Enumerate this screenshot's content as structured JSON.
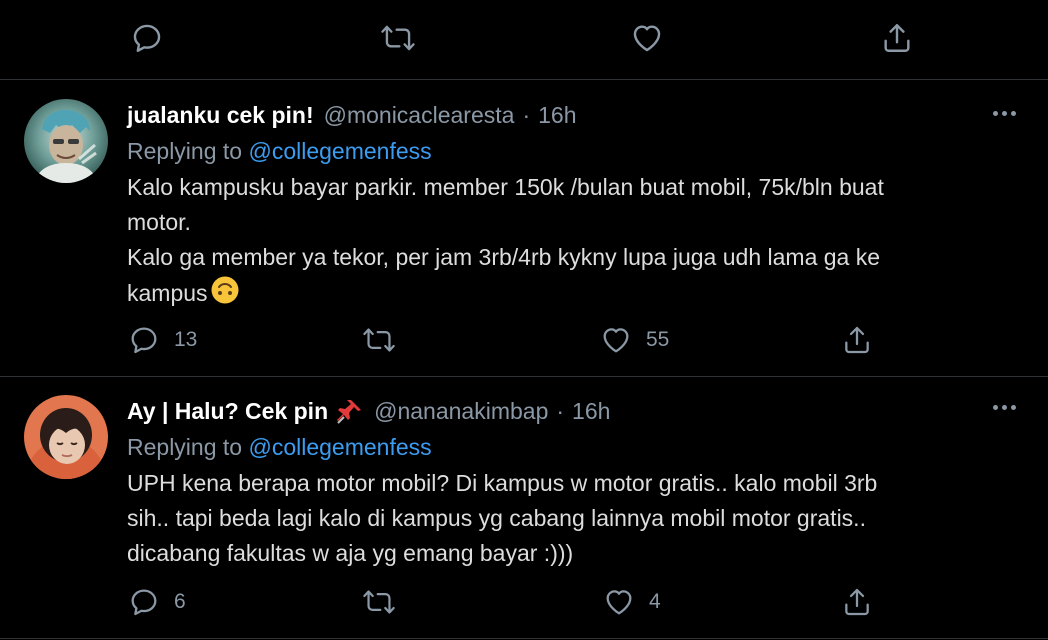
{
  "top_actions": {
    "reply_count": "",
    "retweet_count": "",
    "like_count": ""
  },
  "tweets": [
    {
      "display_name": "jualanku cek pin!",
      "handle": "@monicaclearesta",
      "separator": "·",
      "time": "16h",
      "replying_prefix": "Replying to",
      "replying_to": "@collegemenfess",
      "lines": [
        "Kalo kampusku bayar parkir. member 150k /bulan buat mobil, 75k/bln buat",
        "motor.",
        "Kalo ga member ya tekor, per jam 3rb/4rb kykny lupa juga udh lama ga ke",
        "kampus"
      ],
      "emoji_icon": "upside-down-face-emoji",
      "reply_count": "13",
      "retweet_count": "",
      "like_count": "55"
    },
    {
      "display_name": "Ay | Halu? Cek pin",
      "name_icon": "pushpin-emoji",
      "handle": "@nananakimbap",
      "separator": "·",
      "time": "16h",
      "replying_prefix": "Replying to",
      "replying_to": "@collegemenfess",
      "lines": [
        "UPH kena berapa motor mobil? Di kampus w motor gratis.. kalo mobil 3rb",
        "sih.. tapi beda lagi kalo di kampus yg cabang lainnya mobil motor gratis..",
        "dicabang fakultas w aja yg emang bayar :)))"
      ],
      "reply_count": "6",
      "retweet_count": "",
      "like_count": "4"
    }
  ],
  "colors": {
    "background": "#000000",
    "text": "#d9d9d9",
    "muted": "#8b98a5",
    "link": "#3b9cf0",
    "divider": "#2f3336"
  }
}
